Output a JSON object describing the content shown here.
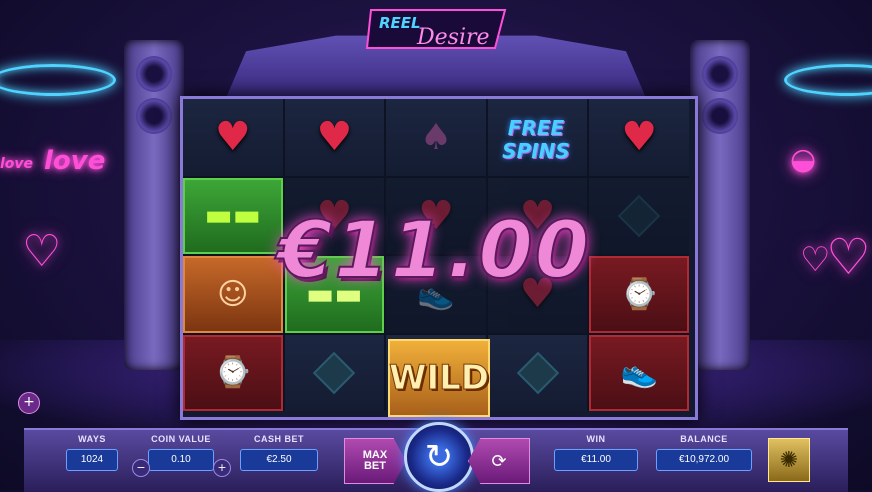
{
  "game": {
    "logo_line1": "REEL",
    "logo_line2": "Desire"
  },
  "win_display": "€11.00",
  "reels": {
    "wild_label": "WILD",
    "freespins_line1": "FREE",
    "freespins_line2": "SPINS"
  },
  "background_signs": {
    "left_sign_small": "love",
    "left_sign_big": "love"
  },
  "controls": {
    "ways_label": "WAYS",
    "ways_value": "1024",
    "coin_value_label": "COIN VALUE",
    "coin_value": "0.10",
    "coin_minus": "−",
    "coin_plus": "+",
    "cash_bet_label": "CASH BET",
    "cash_bet_value": "€2.50",
    "max_bet_line1": "MAX",
    "max_bet_line2": "BET",
    "win_label": "WIN",
    "win_value": "€11.00",
    "balance_label": "BALANCE",
    "balance_value": "€10,972.00"
  },
  "colors": {
    "neon_pink": "#ff4fd8",
    "neon_blue": "#4fd4ff",
    "field_blue": "#1a3a9a"
  }
}
